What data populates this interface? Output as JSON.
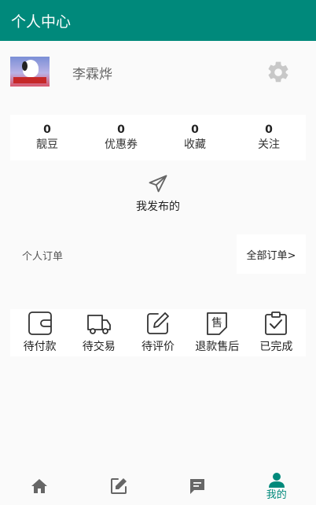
{
  "app": {
    "title": "个人中心",
    "accent": "#00897b"
  },
  "profile": {
    "username": "李霖烨"
  },
  "stats": [
    {
      "value": "0",
      "label": "靓豆"
    },
    {
      "value": "0",
      "label": "优惠券"
    },
    {
      "value": "0",
      "label": "收藏"
    },
    {
      "value": "0",
      "label": "关注"
    }
  ],
  "published": {
    "label": "我发布的",
    "icon": "send-icon"
  },
  "orders": {
    "title": "个人订单",
    "all_label": "全部订单>",
    "items": [
      {
        "label": "待付款",
        "icon": "wallet-icon"
      },
      {
        "label": "待交易",
        "icon": "truck-icon"
      },
      {
        "label": "待评价",
        "icon": "edit-icon"
      },
      {
        "label": "退款售后",
        "icon": "after-sale-icon",
        "glyph": "售"
      },
      {
        "label": "已完成",
        "icon": "clipboard-check-icon"
      }
    ]
  },
  "bottom_nav": [
    {
      "icon": "home-icon",
      "label": ""
    },
    {
      "icon": "compose-icon",
      "label": ""
    },
    {
      "icon": "message-icon",
      "label": ""
    },
    {
      "icon": "person-icon",
      "label": "我的",
      "active": true
    }
  ]
}
